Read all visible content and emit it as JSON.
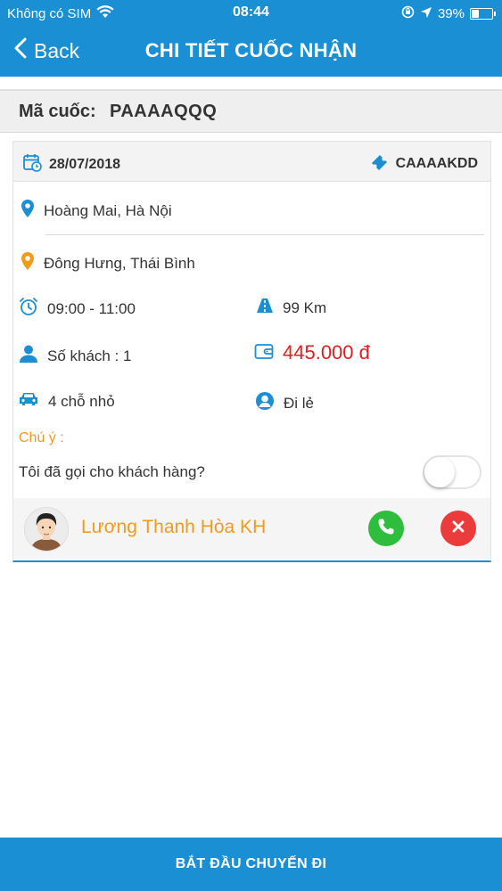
{
  "status_bar": {
    "carrier": "Không có SIM",
    "time": "08:44",
    "battery_text": "39%",
    "battery_level": 0.39
  },
  "navbar": {
    "back_label": "Back",
    "title": "CHI TIẾT CUỐC NHẬN"
  },
  "trip_code": {
    "label": "Mã cuốc:",
    "value": "PAAAAQQQ"
  },
  "card": {
    "date": "28/07/2018",
    "ticket_code": "CAAAAKDD",
    "pickup": "Hoàng Mai, Hà Nội",
    "dropoff": "Đông Hưng, Thái Bình",
    "time_range": "09:00 - 11:00",
    "distance": "99 Km",
    "passengers": "Số khách :  1",
    "price": "445.000 đ",
    "vehicle": "4 chỗ nhỏ",
    "trip_type": "Đi lẻ",
    "note_label": "Chú ý :",
    "call_question": "Tôi đã gọi cho khách hàng?",
    "called_toggle_on": false
  },
  "contact": {
    "name": "Lương Thanh Hòa KH"
  },
  "bottom_button": {
    "label": "BẮT ĐẦU CHUYẾN ĐI"
  },
  "colors": {
    "primary": "#1a8fd3",
    "accent_orange": "#f39a1a",
    "price_red": "#e02020",
    "call_green": "#2ebd3c",
    "cancel_red": "#ec3b3b"
  }
}
